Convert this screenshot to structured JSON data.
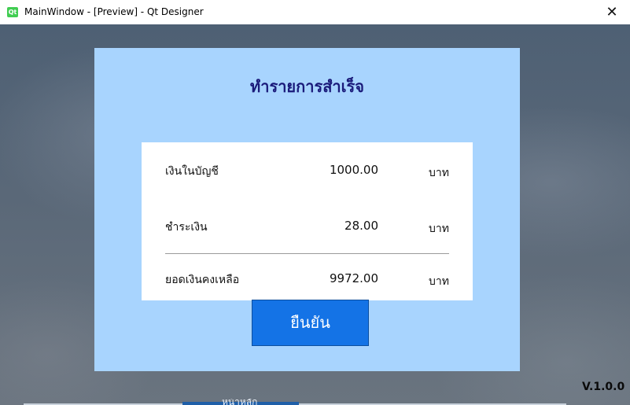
{
  "window": {
    "title": "MainWindow - [Preview] - Qt Designer",
    "icon_label": "Qt",
    "close_glyph": "✕"
  },
  "background": {
    "bottom_peek_text": "หน้าหลัก",
    "version": "V.1.0.0"
  },
  "dialog": {
    "title": "ทำรายการสำเร็จ",
    "rows": [
      {
        "label": "เงินในบัญชี",
        "amount": "1000.00",
        "unit": "บาท"
      },
      {
        "label": "ชำระเงิน",
        "amount": "28.00",
        "unit": "บาท"
      },
      {
        "label": "ยอดเงินคงเหลือ",
        "amount": "9972.00",
        "unit": "บาท"
      }
    ],
    "confirm_label": "ยืนยัน"
  },
  "colors": {
    "dialog_bg": "#a8d4fe",
    "title_color": "#1a1a7a",
    "button_bg": "#1473e6"
  }
}
